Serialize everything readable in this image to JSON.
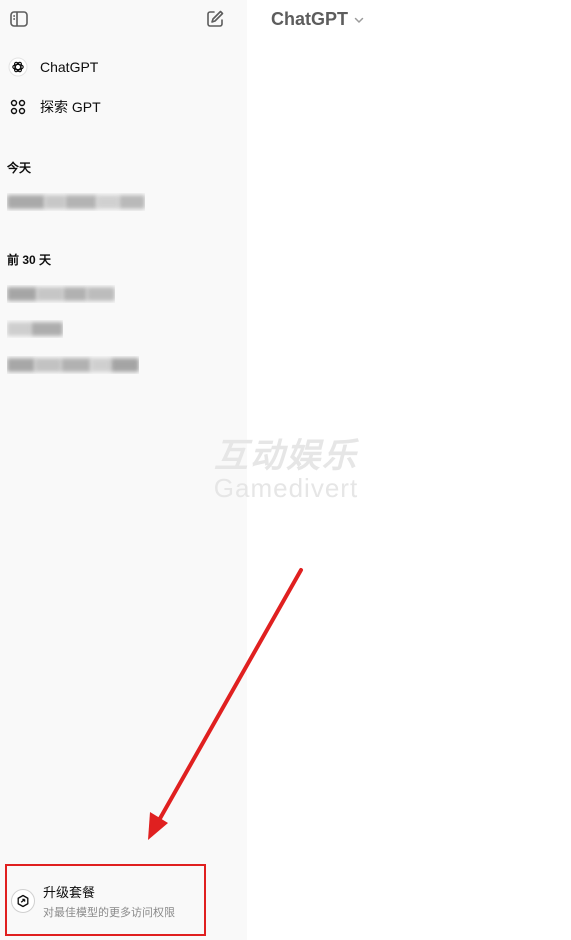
{
  "sidebar": {
    "nav": [
      {
        "label": "ChatGPT",
        "icon": "openai-logo-icon"
      },
      {
        "label": "探索 GPT",
        "icon": "grid-dots-icon"
      }
    ],
    "sections": [
      {
        "title": "今天"
      },
      {
        "title": "前 30 天"
      }
    ],
    "upgrade": {
      "title": "升级套餐",
      "subtitle": "对最佳模型的更多访问权限",
      "icon": "upgrade-badge-icon"
    }
  },
  "header": {
    "model_name": "ChatGPT"
  },
  "watermark": {
    "cn": "互动娱乐",
    "en": "Gamedivert"
  },
  "annotations": {
    "arrow_color": "#e02020",
    "box_color": "#e02020"
  }
}
